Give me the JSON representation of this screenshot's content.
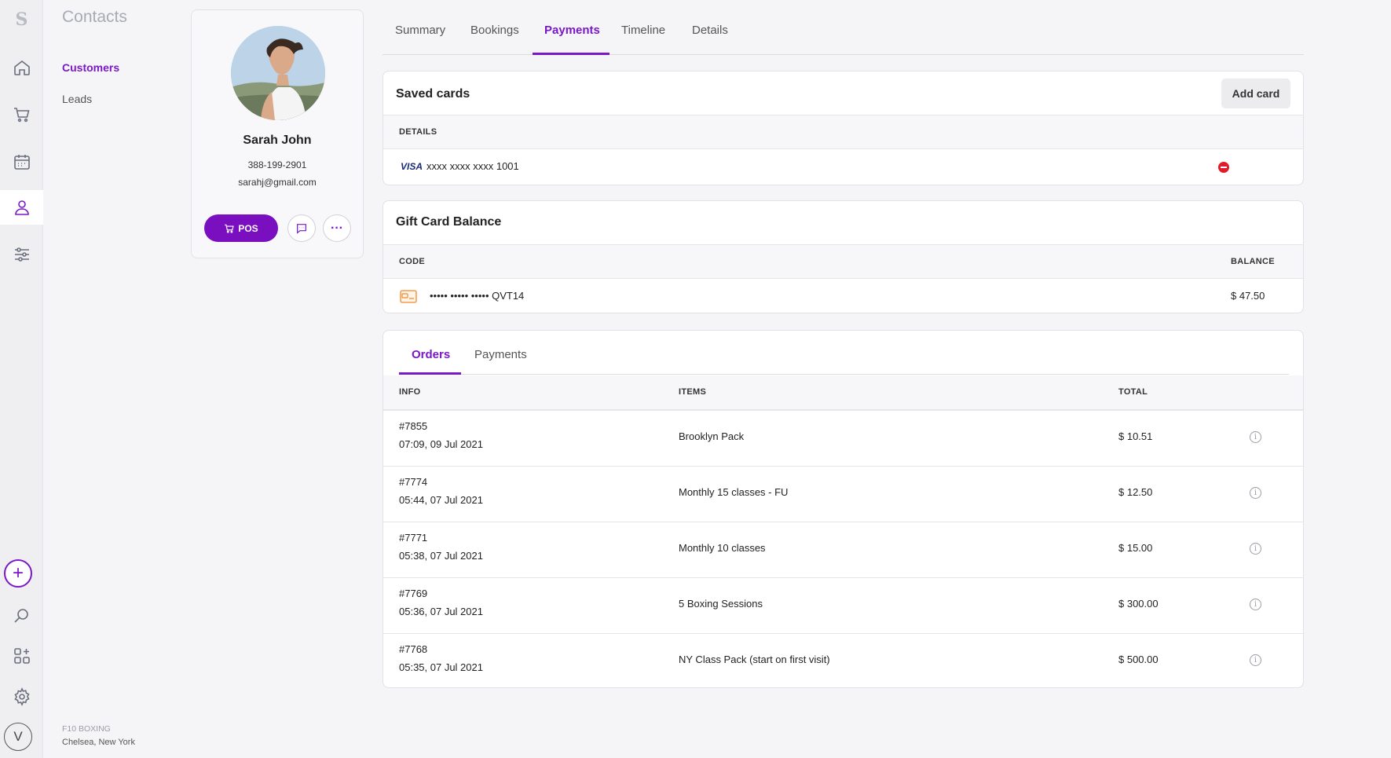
{
  "app": {
    "logo": "S"
  },
  "rail": {
    "icons": [
      "home-icon",
      "cart-icon",
      "calendar-icon",
      "user-icon",
      "sliders-icon",
      "plus-icon",
      "search-icon",
      "apps-icon",
      "gear-icon"
    ],
    "avatar_letter": "V",
    "active_icon": "user-icon"
  },
  "subnav": {
    "title": "Contacts",
    "items": [
      {
        "label": "Customers",
        "active": true
      },
      {
        "label": "Leads",
        "active": false
      }
    ],
    "business": "F10 BOXING",
    "location": "Chelsea, New York"
  },
  "profile": {
    "name": "Sarah John",
    "phone": "388-199-2901",
    "email": "sarahj@gmail.com",
    "pos_label": "POS"
  },
  "tabs": [
    {
      "label": "Summary",
      "active": false
    },
    {
      "label": "Bookings",
      "active": false
    },
    {
      "label": "Payments",
      "active": true
    },
    {
      "label": "Timeline",
      "active": false
    },
    {
      "label": "Details",
      "active": false
    }
  ],
  "saved_cards": {
    "title": "Saved cards",
    "add_label": "Add card",
    "col_details": "DETAILS",
    "cards": [
      {
        "brand": "VISA",
        "number": "xxxx xxxx xxxx 1001"
      }
    ]
  },
  "gift_card": {
    "title": "Gift Card Balance",
    "col_code": "CODE",
    "col_balance": "BALANCE",
    "code": "••••• ••••• ••••• QVT14",
    "balance": "$ 47.50"
  },
  "orders": {
    "tabs": [
      {
        "label": "Orders",
        "active": true
      },
      {
        "label": "Payments",
        "active": false
      }
    ],
    "col_info": "INFO",
    "col_items": "ITEMS",
    "col_total": "TOTAL",
    "rows": [
      {
        "id": "#7855",
        "date": "07:09, 09 Jul 2021",
        "items": "Brooklyn Pack",
        "total": "$ 10.51"
      },
      {
        "id": "#7774",
        "date": "05:44, 07 Jul 2021",
        "items": "Monthly 15 classes - FU",
        "total": "$ 12.50"
      },
      {
        "id": "#7771",
        "date": "05:38, 07 Jul 2021",
        "items": "Monthly 10 classes",
        "total": "$ 15.00"
      },
      {
        "id": "#7769",
        "date": "05:36, 07 Jul 2021",
        "items": "5 Boxing Sessions",
        "total": "$ 300.00"
      },
      {
        "id": "#7768",
        "date": "05:35, 07 Jul 2021",
        "items": "NY Class Pack (start on first visit)",
        "total": "$ 500.00"
      }
    ]
  },
  "colors": {
    "accent": "#7a18c8",
    "danger": "#e01b2a"
  }
}
